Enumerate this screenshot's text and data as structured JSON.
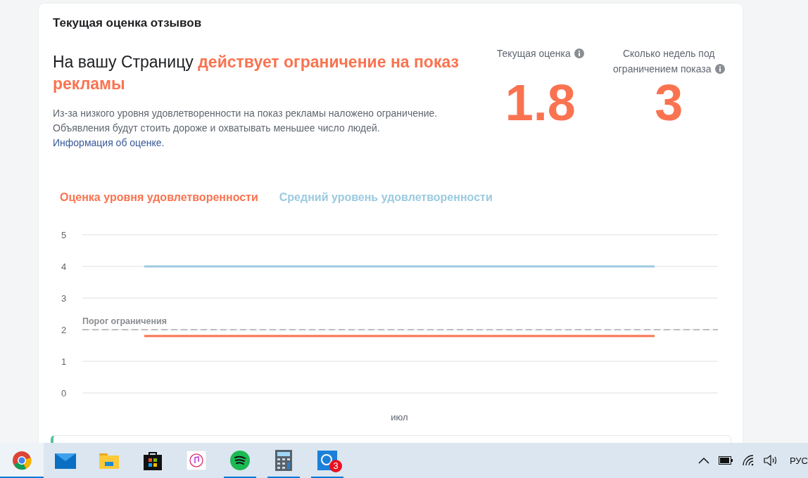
{
  "card": {
    "title": "Текущая оценка отзывов",
    "headline": "На вашу Страницу **действует ограничение на показ рекламы**",
    "description": "Из-за низкого уровня удовлетворенности на показ рекламы наложено ограничение. Объявления будут стоить дороже и охватывать меньшее число людей.",
    "link": "Информация об оценке.",
    "stats": [
      {
        "label": "Текущая оценка",
        "value": "1.8",
        "info": true
      },
      {
        "label": "Сколько недель под ограничением показа",
        "value": "3",
        "info": true
      }
    ],
    "chart_data": {
      "type": "line",
      "ylim": [
        0,
        5
      ],
      "yticks": [
        0,
        1,
        2,
        3,
        4,
        5
      ],
      "grid": true,
      "series": [
        {
          "name": "Оценка уровня удовлетворенности",
          "color": "#fa7350",
          "values": [
            1.8,
            1.8
          ]
        },
        {
          "name": "Средний уровень удовлетворенности",
          "color": "#9bcadf",
          "values": [
            4,
            4
          ]
        }
      ],
      "ref_lines": [
        {
          "axis": "y",
          "value": 2,
          "label": "Порог ограничения"
        }
      ],
      "annotations": [
        {
          "text": "июл"
        }
      ]
    }
  },
  "taskbar": {
    "items": [
      {
        "kind": "chrome",
        "running": true,
        "selected": true
      },
      {
        "kind": "mail",
        "running": false,
        "selected": false
      },
      {
        "kind": "explorer",
        "running": false,
        "selected": false
      },
      {
        "kind": "store",
        "running": false,
        "selected": false
      },
      {
        "kind": "music",
        "running": false,
        "selected": false
      },
      {
        "kind": "spotify",
        "running": true,
        "selected": false
      },
      {
        "kind": "calculator",
        "running": true,
        "selected": false
      },
      {
        "kind": "chat",
        "running": true,
        "selected": false,
        "badge": "3"
      }
    ],
    "language": "РУС"
  }
}
